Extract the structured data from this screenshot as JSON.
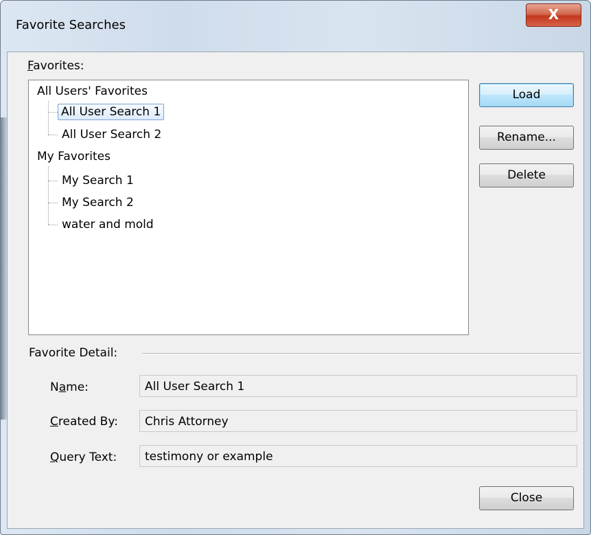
{
  "window": {
    "title": "Favorite Searches",
    "close_glyph": "X"
  },
  "favorites": {
    "label_prefix": "F",
    "label_rest": "avorites:",
    "groups": [
      {
        "label": "All Users' Favorites",
        "items": [
          "All User Search 1",
          "All User Search 2"
        ]
      },
      {
        "label": "My Favorites",
        "items": [
          "My Search 1",
          "My Search 2",
          "water and mold"
        ]
      }
    ],
    "selected": "All User Search 1"
  },
  "buttons": {
    "load": "Load",
    "rename": "Rename...",
    "delete": "Delete",
    "close": "Close"
  },
  "detail": {
    "section_label": "Favorite Detail:",
    "name_label_pre": "N",
    "name_label_ul": "a",
    "name_label_post": "me:",
    "name_value": "All User Search 1",
    "created_label_ul": "C",
    "created_label_post": "reated By:",
    "created_value": "Chris Attorney",
    "query_label_ul": "Q",
    "query_label_post": "uery Text:",
    "query_value": "testimony or example"
  }
}
